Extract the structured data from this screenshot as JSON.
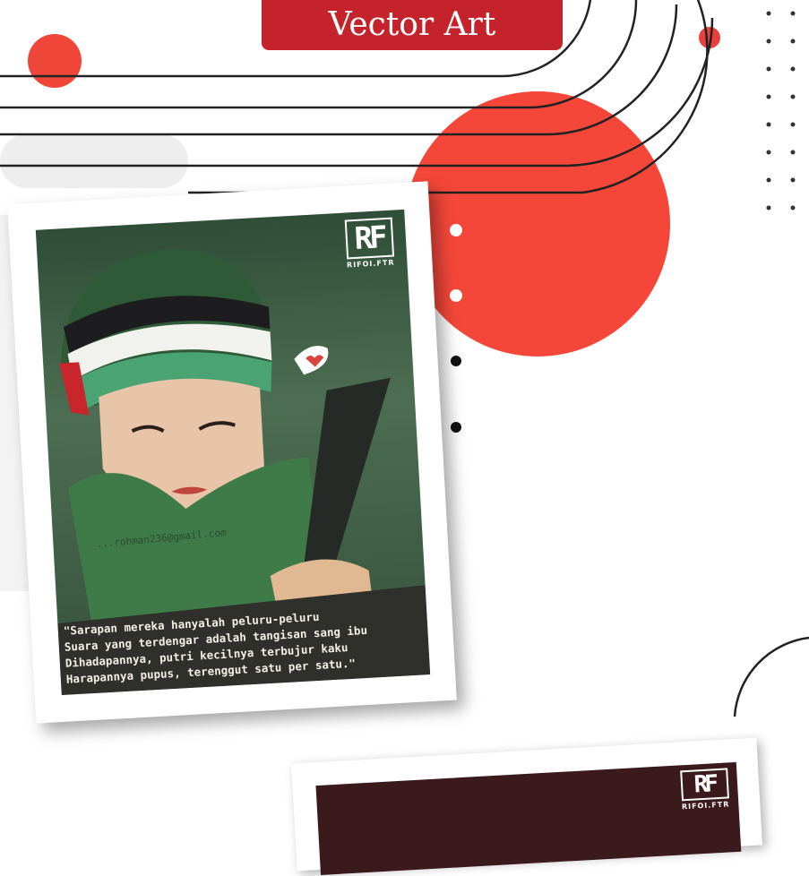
{
  "header": {
    "title": "Vector Art"
  },
  "artwork": {
    "logo_mark": "RF",
    "logo_text": "RIFOI.FTR",
    "watermark_email": "...rohman236@gmail.com",
    "quote_lines": [
      "\"Sarapan mereka hanyalah peluru-peluru",
      "Suara yang terdengar adalah tangisan sang ibu",
      "Dihadapannya, putri kecilnya terbujur kaku",
      "Harapannya pupus, terenggut satu per satu.\""
    ]
  },
  "second_artwork": {
    "logo_mark": "RF",
    "logo_text": "RIFOI.FTR"
  },
  "colors": {
    "accent_red": "#f0463a",
    "banner_red": "#c4232b",
    "scarf_green": "#3e7a48"
  }
}
